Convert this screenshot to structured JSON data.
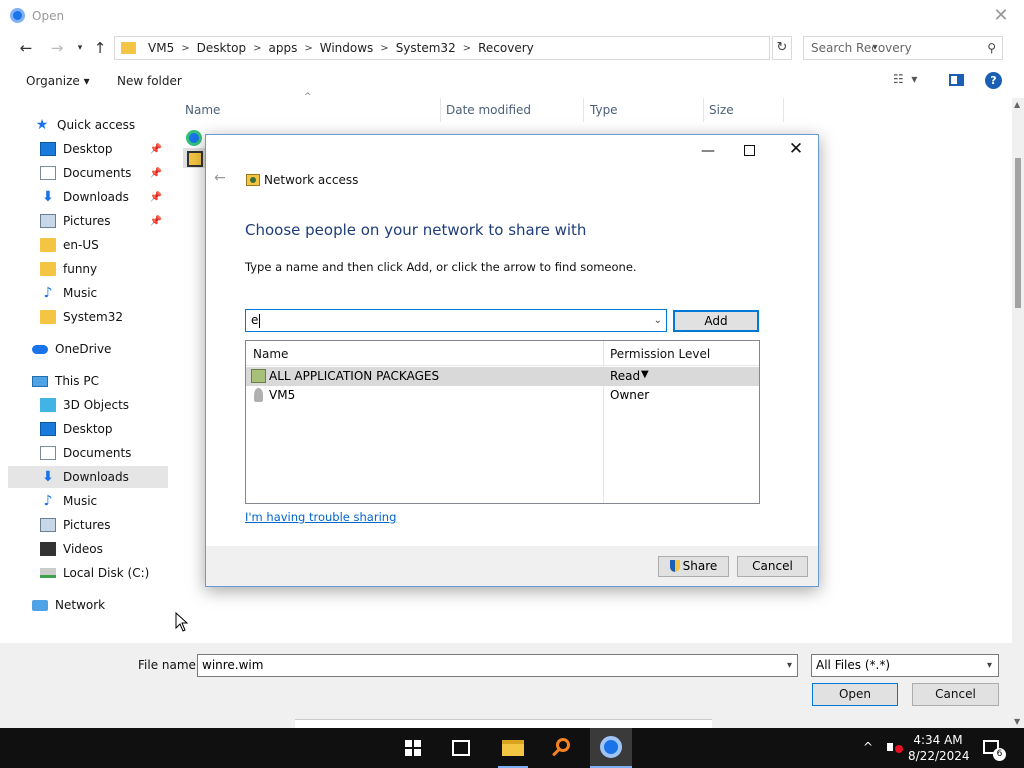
{
  "window": {
    "title": "Open"
  },
  "address": {
    "crumbs": [
      "VM5",
      "Desktop",
      "apps",
      "Windows",
      "System32",
      "Recovery"
    ],
    "search_placeholder": "Search Recovery"
  },
  "toolbar": {
    "organize": "Organize ▾",
    "new_folder": "New folder"
  },
  "nav": {
    "items": [
      {
        "label": "Quick access"
      },
      {
        "label": "Desktop"
      },
      {
        "label": "Documents"
      },
      {
        "label": "Downloads"
      },
      {
        "label": "Pictures"
      },
      {
        "label": "en-US"
      },
      {
        "label": "funny"
      },
      {
        "label": "Music"
      },
      {
        "label": "System32"
      },
      {
        "label": "OneDrive"
      },
      {
        "label": "This PC"
      },
      {
        "label": "3D Objects"
      },
      {
        "label": "Desktop"
      },
      {
        "label": "Documents"
      },
      {
        "label": "Downloads"
      },
      {
        "label": "Music"
      },
      {
        "label": "Pictures"
      },
      {
        "label": "Videos"
      },
      {
        "label": "Local Disk (C:)"
      },
      {
        "label": "Network"
      }
    ]
  },
  "columns": {
    "name": "Name",
    "date": "Date modified",
    "type": "Type",
    "size": "Size"
  },
  "bottom": {
    "file_name_label": "File name:",
    "file_name_value": "winre.wim",
    "file_type": "All Files (*.*)",
    "open": "Open",
    "cancel": "Cancel"
  },
  "network_access": {
    "title": "Network access",
    "heading": "Choose people on your network to share with",
    "instruction": "Type a name and then click Add, or click the arrow to find someone.",
    "input_value": "e",
    "add": "Add",
    "col_name": "Name",
    "col_perm": "Permission Level",
    "rows": [
      {
        "name": "ALL APPLICATION PACKAGES",
        "perm": "Read"
      },
      {
        "name": "VM5",
        "perm": "Owner"
      }
    ],
    "trouble_link": "I'm having trouble sharing",
    "share": "Share",
    "cancel": "Cancel"
  },
  "taskbar": {
    "time": "4:34 AM",
    "date": "8/22/2024",
    "notifications": "6"
  }
}
